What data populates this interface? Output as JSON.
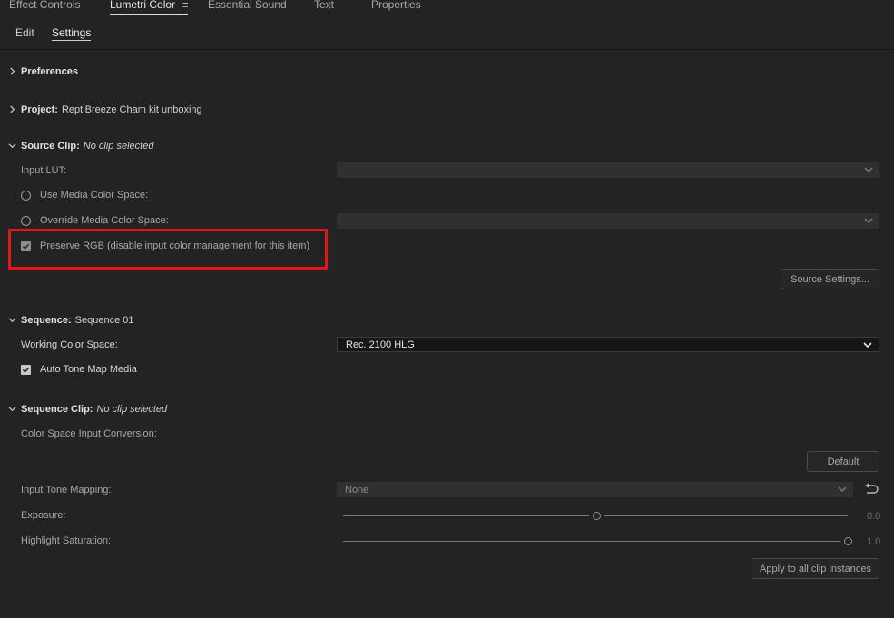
{
  "tabs": [
    {
      "label": "Effect Controls"
    },
    {
      "label": "Lumetri Color",
      "menu": "≡"
    },
    {
      "label": "Essential Sound"
    },
    {
      "label": "Text"
    },
    {
      "label": "Properties"
    }
  ],
  "subtabs": [
    {
      "label": "Edit"
    },
    {
      "label": "Settings"
    }
  ],
  "preferences": {
    "label": "Preferences"
  },
  "project": {
    "label": "Project:",
    "value": "ReptiBreeze Cham kit unboxing"
  },
  "source_clip": {
    "label": "Source Clip:",
    "value": "No clip selected",
    "input_lut_label": "Input LUT:",
    "use_media_label": "Use Media Color Space:",
    "override_label": "Override Media Color Space:",
    "preserve_rgb_label": "Preserve RGB (disable input color management for this item)",
    "source_settings_button": "Source Settings..."
  },
  "sequence": {
    "label": "Sequence:",
    "value": "Sequence 01",
    "working_space_label": "Working Color Space:",
    "working_space_value": "Rec. 2100 HLG",
    "auto_tone_label": "Auto Tone Map Media"
  },
  "sequence_clip": {
    "label": "Sequence Clip:",
    "value": "No clip selected",
    "conversion_label": "Color Space Input Conversion:",
    "default_button": "Default",
    "tone_mapping_label": "Input Tone Mapping:",
    "tone_mapping_value": "None",
    "exposure_label": "Exposure:",
    "exposure_value": "0.0",
    "highlight_label": "Highlight Saturation:",
    "highlight_value": "1.0",
    "apply_button": "Apply to all clip instances"
  },
  "colors": {
    "highlight_box": "#e0161c",
    "background": "#232323"
  }
}
